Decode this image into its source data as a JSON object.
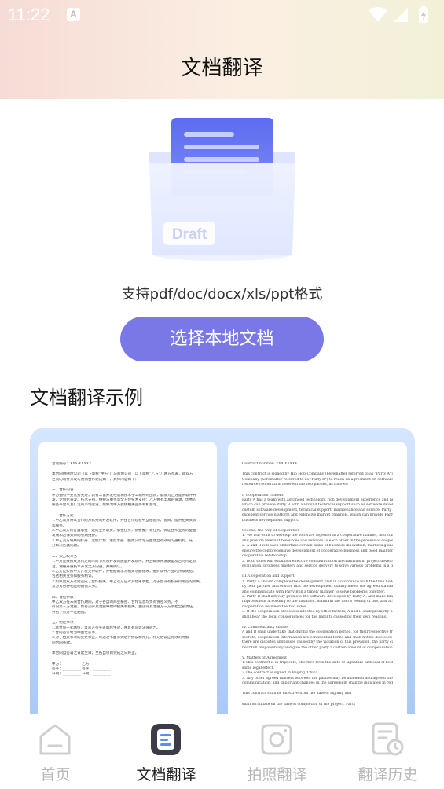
{
  "status_bar": {
    "time": "11:22",
    "notification_letter": "A"
  },
  "header": {
    "title": "文档翻译"
  },
  "illustration": {
    "badge": "Draft"
  },
  "upload": {
    "support_text": "支持pdf/doc/docx/xls/ppt格式",
    "button_label": "选择本地文档"
  },
  "examples": {
    "title": "文档翻译示例",
    "left_doc_lines": [
      "合同编号：XXX-XXXXX",
      "",
      "本合同由嘻哈公司（以下简称“甲方”）与南地公司（以下简称“乙方”）两方签署，就双方",
      "之间的软件开发与营销合作达成如下，具体内容如下：",
      "",
      "一、合作内容",
      "甲方拥有一支优秀先进，具有丰富开发经验和技术手工精神的团队，能够为乙方提供软件开",
      "发、定制化开发、技术支持、维护与服务等全方位技术支持；乙方拥有丰富的资源，优秀的",
      "服务平台以及广泛的市场渠道，能够为甲方提供相关业务和机会等。",
      "",
      "二、合作方式",
      "1.甲乙双方将以合作的方式共同开发软件，并在合作过程中互相协作，协商，提供相关资源",
      "和服务。",
      "2.甲乙双方将各自承担一定的业务职责，承担任务，销售推广等任务，保证合作业务的全面",
      "发展和合作关系的长期维护。",
      "3.甲乙双方将共同打开、定程计划、进度掌握、服务交付等方面建立有效的沟通机制，充",
      "分解决各类问题。",
      "",
      "三、双方权义务",
      "1.甲方应按照双方约定的时间节点和开发的质量开发软件，并且确保开发质量及合同约定标",
      "准，遵循开展技术开发之方向通，并阐确认。",
      "2.乙方应按照甲方开发交付软件，并根据需求对相关功能修改，维护软件产品的持续优化，",
      "包括相关业务和服务制订。",
      "3.如果因双方过错造成了合作损失，甲乙双方应对其结果承担，对于因非有权获得所造的损失，",
      "双方对各种相应的赔偿义务。",
      "",
      "四、保密条款",
      "甲乙双方在未来合作期间，对于各自的商业秘密、合作信息均负有保密义务，不",
      "得向第三方泄露，如有违背及泄露导致的损失和损失，由违背及泄露方一方承担全部责任，",
      "并给予对方一定赔偿。",
      "",
      "五、约定事项",
      "1.本合同一式两份，自双方签字盖章后生效，并具有同等法律效力。",
      "2.合同签订地为中国北京市。",
      "3.对于相关事项的变更事宜，可通过书面形式进行协议和补充，补充协议应有效的附加",
      "同合同条款。",
      "",
      "本合同自签署之日起生效，至各自项目完成之日终止。",
      "",
      "甲方：__________    乙方：__________",
      "签字：__________    签字：__________",
      "日期：__________    日期：__________"
    ],
    "right_doc_lines": [
      "Contract number: XXX-XXXXX",
      "",
      "This contract is signed by Hip Hop Company (hereinafter referred to as \"Party A\") and Ho Ho",
      "Company (hereinafter referred to as \"Party B\") to reach an agreement on software development and",
      "resource cooperation between the two parties, as follows:",
      "",
      "I. Cooperation content",
      "Party A has a team with advanced technology, rich development experience and high-level engineers,",
      "which can provide Party B with all-round technical support such as software development,",
      "custom software development, technical support, maintenance and service. Party B has rich resources,",
      "excellent service platform and extensive market channels, which can provide Party A with relevant",
      "business development support.",
      "",
      "Second, the way of cooperation",
      "1. We will work to develop the software together in a cooperative manner, and collaborate, coordinate",
      "and provide relevant resources and services to each other in the process of cooperation.",
      "2. A and B will each undertake certain tasks of business innovation, marketing and sales promotion to",
      "ensure the comprehensive development of cooperative business and good maintenance of",
      "cooperative relationship.",
      "3. Both sides will establish effective communication mechanisms in project development, process",
      "evaluation, progress mastery and service delivery to solve various problems in a timely manner.",
      "",
      "III. Cooperation and support",
      "1. Party A should complete the development plan in accordance with the time nodes and targets agreed",
      "by both parties, and ensure that the development quality meets the agreed standards of the contract,",
      "and communicate with Party B in a timely manner to solve problems together.",
      "2. Party B shall actively promote the software developed by Party A, and make timely suggestions for",
      "improvement according to the situation, maintain the user's feeling of use, and achieve the goal of win-win",
      "cooperation between the two sides.",
      "3. If the cooperation process is affected by other factors, A and B shall promptly negotiate a solution. Both parties",
      "shall bear the legal consequences for the liability caused by their own reasons.",
      "",
      "IV. Confidentiality clause",
      "A and B shall undertake that during the cooperation period, for their respective trade secrets, technical",
      "secrets, cooperation information are confidential terms and shall not be disclosed to third parties. If",
      "there are disputes and losses caused by the violation of this provision, the party causing the loss shall",
      "bear full responsibility and give the other party a certain amount of compensation.",
      "",
      "V. Matters of Agreement",
      "1.This contract is in triplicate, effective from the date of signature and seal of both parties, and has the",
      "same legal effect.",
      "2.The contract is signed in Beijing, China.",
      "3. Any other agreed matters between the parties may be amended and agreed through written",
      "communication, and important changes in the agreement shall be indicated in red letters in the title.",
      "",
      "This contract shall be effective from the date of signing and",
      "",
      "shall terminate on the date of completion of the project. Party"
    ]
  },
  "bottom_nav": {
    "items": [
      {
        "label": "首页",
        "icon": "home-icon",
        "active": false
      },
      {
        "label": "文档翻译",
        "icon": "document-icon",
        "active": true
      },
      {
        "label": "拍照翻译",
        "icon": "camera-icon",
        "active": false
      },
      {
        "label": "翻译历史",
        "icon": "history-icon",
        "active": false
      }
    ]
  },
  "colors": {
    "accent": "#7a78e6",
    "header_gradient_start": "#f6dcd6",
    "header_gradient_end": "#f2f1d8",
    "card_blue": "#a8c8f6",
    "nav_inactive": "#b8b8b8",
    "nav_active": "#222222"
  }
}
